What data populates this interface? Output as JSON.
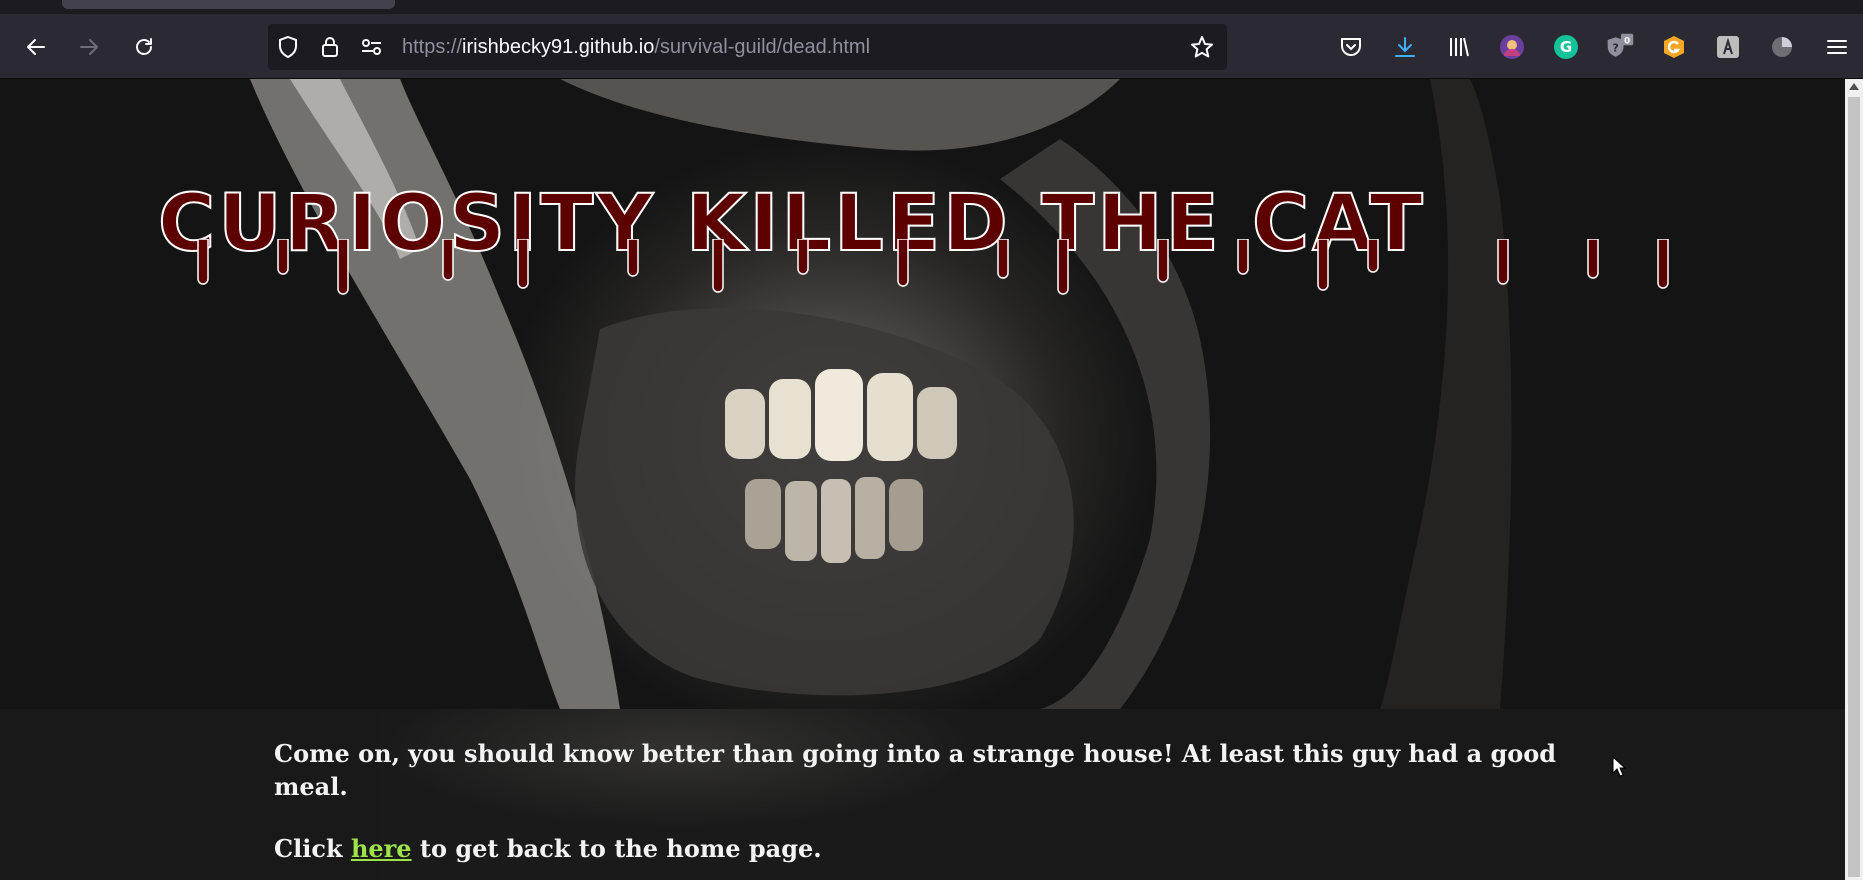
{
  "browser": {
    "url_prefix": "https://",
    "url_host": "irishbecky91.github.io",
    "url_path": "/survival-guild/dead.html",
    "extension_badge": "0"
  },
  "page": {
    "headline": "CURIOSITY KILLED THE CAT",
    "paragraph_1": "Come on, you should know better than going into a strange house! At least this guy had a good meal.",
    "paragraph_2_before": "Click ",
    "paragraph_2_link": "here",
    "paragraph_2_after": " to get back to the home page."
  },
  "colors": {
    "headline_fill": "#5c0000",
    "headline_outline": "#ffffff",
    "link": "#9ee24a",
    "text": "#f3f3f3"
  },
  "icons": [
    "back-arrow-icon",
    "forward-arrow-icon",
    "reload-icon",
    "shield-icon",
    "lock-icon",
    "permissions-icon",
    "bookmark-star-icon",
    "pocket-icon",
    "download-icon",
    "library-icon",
    "avatar-extension-icon",
    "grammarly-icon",
    "password-manager-icon",
    "g-extension-icon",
    "a-extension-icon",
    "pie-extension-icon",
    "hamburger-menu-icon"
  ]
}
